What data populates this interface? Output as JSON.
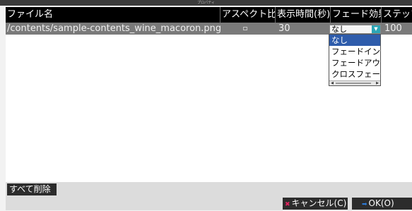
{
  "window": {
    "title": "プロパティ"
  },
  "table": {
    "columns": [
      "ファイル名",
      "アスペクト比",
      "表示時間(秒)",
      "フェード効果",
      "ステップ"
    ],
    "rows": [
      {
        "file": "/contents/sample-contents_wine_macoron.png",
        "duration": "30",
        "fade": "なし",
        "step": "100"
      }
    ]
  },
  "fade_dropdown": {
    "options": [
      "なし",
      "フェードイン",
      "フェードアウト",
      "クロスフェード"
    ],
    "selected_index": 0
  },
  "footer": {
    "delete_all_label": "すべて削除",
    "cancel_label": "キャンセル(C)",
    "ok_label": "OK(O)"
  },
  "colors": {
    "header_bg": "#000000",
    "row_bg": "#7a7a7a",
    "dropdown_selected": "#2e5cab",
    "select_arrow": "#2ba5b5",
    "cancel_icon": "#e0245e",
    "ok_icon": "#2e7bd6"
  },
  "icons": [
    "chevron-down-icon",
    "cancel-x-icon",
    "ok-check-icon"
  ]
}
